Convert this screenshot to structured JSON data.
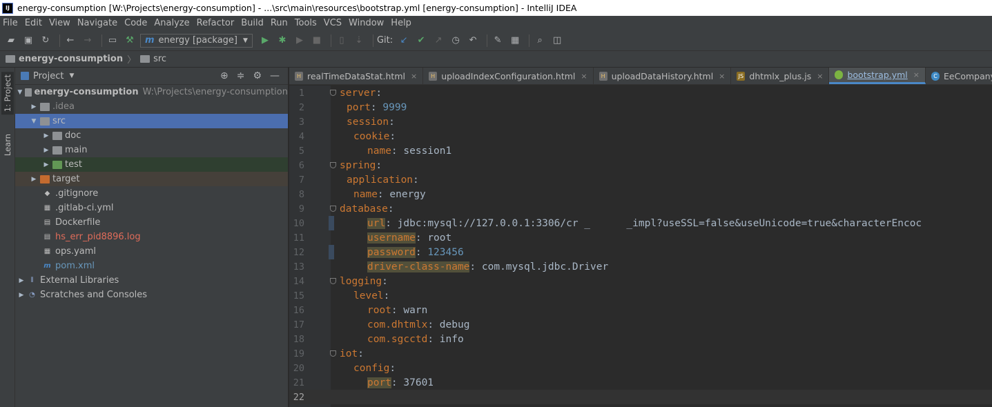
{
  "window": {
    "title": "energy-consumption [W:\\Projects\\energy-consumption] - ...\\src\\main\\resources\\bootstrap.yml [energy-consumption] - IntelliJ IDEA",
    "logo": "IJ"
  },
  "menu": [
    "File",
    "Edit",
    "View",
    "Navigate",
    "Code",
    "Analyze",
    "Refactor",
    "Build",
    "Run",
    "Tools",
    "VCS",
    "Window",
    "Help"
  ],
  "toolbar": {
    "run_config": "energy [package]",
    "git_label": "Git:"
  },
  "breadcrumb": {
    "project": "energy-consumption",
    "folder": "src"
  },
  "sidebar": {
    "project_tab": "1: Project",
    "learn_tab": "Learn"
  },
  "project_panel": {
    "title": "Project",
    "root_name": "energy-consumption",
    "root_path": "W:\\Projects\\energy-consumption",
    "items": {
      "idea": ".idea",
      "src": "src",
      "doc": "doc",
      "main": "main",
      "test": "test",
      "target": "target",
      "gitignore": ".gitignore",
      "gitlab_ci": ".gitlab-ci.yml",
      "dockerfile": "Dockerfile",
      "hs_err": "hs_err_pid8896.log",
      "ops": "ops.yaml",
      "pom": "pom.xml",
      "ext_libs": "External Libraries",
      "scratches": "Scratches and Consoles"
    }
  },
  "editor_tabs": [
    {
      "label": "realTimeDataStat.html",
      "kind": "html"
    },
    {
      "label": "uploadIndexConfiguration.html",
      "kind": "html"
    },
    {
      "label": "uploadDataHistory.html",
      "kind": "html"
    },
    {
      "label": "dhtmlx_plus.js",
      "kind": "js"
    },
    {
      "label": "bootstrap.yml",
      "kind": "yml",
      "active": true
    },
    {
      "label": "EeCompanyInfoService",
      "kind": "class"
    }
  ],
  "code_lines": {
    "l1": {
      "key": "server",
      "sep": ":",
      "value": ""
    },
    "l2": {
      "key": "port",
      "sep": ": ",
      "value": "9999"
    },
    "l3": {
      "key": "session",
      "sep": ":",
      "value": ""
    },
    "l4": {
      "key": "cookie",
      "sep": ":",
      "value": ""
    },
    "l5": {
      "key": "name",
      "sep": ": ",
      "value": "session1"
    },
    "l6": {
      "key": "spring",
      "sep": ":",
      "value": ""
    },
    "l7": {
      "key": "application",
      "sep": ":",
      "value": ""
    },
    "l8": {
      "key": "name",
      "sep": ": ",
      "value": "energy"
    },
    "l9": {
      "key": "database",
      "sep": ":",
      "value": ""
    },
    "l10": {
      "key": "url",
      "sep": ": ",
      "value": "jdbc:mysql://127.0.0.1:3306/cr _      _impl?useSSL=false&useUnicode=true&characterEncoc"
    },
    "l11": {
      "key": "username",
      "sep": ": ",
      "value": "root"
    },
    "l12": {
      "key": "password",
      "sep": ": ",
      "value": "123456"
    },
    "l13": {
      "key": "driver-class-name",
      "sep": ": ",
      "value": "com.mysql.jdbc.Driver"
    },
    "l14": {
      "key": "logging",
      "sep": ":",
      "value": ""
    },
    "l15": {
      "key": "level",
      "sep": ":",
      "value": ""
    },
    "l16": {
      "key": "root",
      "sep": ": ",
      "value": "warn"
    },
    "l17": {
      "key": "com.dhtmlx",
      "sep": ": ",
      "value": "debug"
    },
    "l18": {
      "key": "com.sgcctd",
      "sep": ": ",
      "value": "info"
    },
    "l19": {
      "key": "iot",
      "sep": ":",
      "value": ""
    },
    "l20": {
      "key": "config",
      "sep": ":",
      "value": ""
    },
    "l21": {
      "key": "port",
      "sep": ": ",
      "value": "37601"
    },
    "l22": {
      "key": "",
      "sep": "",
      "value": ""
    }
  },
  "line_numbers": [
    "1",
    "2",
    "3",
    "4",
    "5",
    "6",
    "7",
    "8",
    "9",
    "10",
    "11",
    "12",
    "13",
    "14",
    "15",
    "16",
    "17",
    "18",
    "19",
    "20",
    "21",
    "22"
  ]
}
